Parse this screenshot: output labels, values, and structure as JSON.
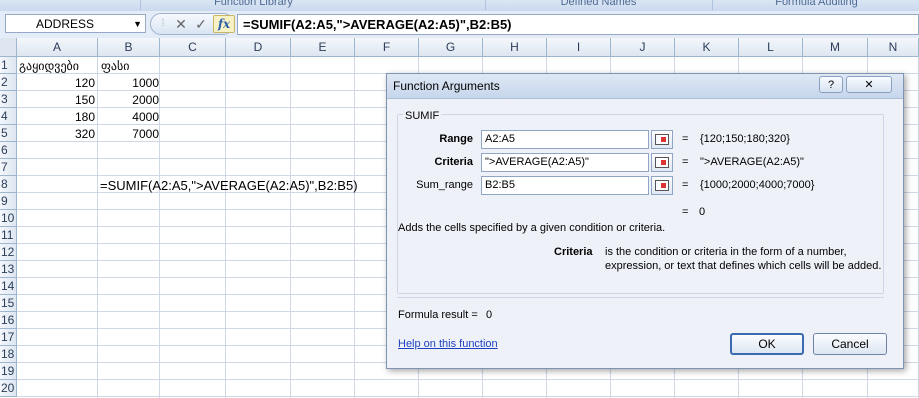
{
  "ribbon": {
    "groups": [
      "Function Library",
      "Defined Names",
      "Formula Auditing"
    ]
  },
  "formula_bar": {
    "name_box": "ADDRESS",
    "cancel_glyph": "✕",
    "enter_glyph": "✓",
    "fx_label": "fx",
    "formula": "=SUMIF(A2:A5,\">AVERAGE(A2:A5)\",B2:B5)"
  },
  "sheet": {
    "columns": [
      "A",
      "B",
      "C",
      "D",
      "E",
      "F",
      "G",
      "H",
      "I",
      "J",
      "K",
      "L",
      "M",
      "N"
    ],
    "rows": [
      "1",
      "2",
      "3",
      "4",
      "5",
      "6",
      "7",
      "8",
      "9",
      "10",
      "11",
      "12",
      "13",
      "14",
      "15",
      "16",
      "17",
      "18",
      "19",
      "20"
    ],
    "a1": "გაყიდვები",
    "b1": "ფასი",
    "a_values": [
      "120",
      "150",
      "180",
      "320"
    ],
    "b_values": [
      "1000",
      "2000",
      "4000",
      "7000"
    ],
    "c8": "=SUMIF(A2:A5,\">AVERAGE(A2:A5)\",B2:B5)"
  },
  "dialog": {
    "title": "Function Arguments",
    "help_btn": "?",
    "close_btn": "✕",
    "function_name": "SUMIF",
    "args": [
      {
        "label": "Range",
        "value": "A2:A5",
        "result": "{120;150;180;320}"
      },
      {
        "label": "Criteria",
        "value": "\">AVERAGE(A2:A5)\"",
        "result": "\">AVERAGE(A2:A5)\""
      },
      {
        "label": "Sum_range",
        "value": "B2:B5",
        "result": "{1000;2000;4000;7000}"
      }
    ],
    "eq": "=",
    "total_result": "0",
    "description": "Adds the cells specified by a given condition or criteria.",
    "criteria_label": "Criteria",
    "criteria_help_1": "is the condition or criteria in the form of a number,",
    "criteria_help_2": "expression, or text that defines which cells will be added.",
    "formula_result_label": "Formula result =",
    "formula_result_value": "0",
    "help_link": "Help on this function",
    "ok_label": "OK",
    "cancel_label": "Cancel"
  }
}
